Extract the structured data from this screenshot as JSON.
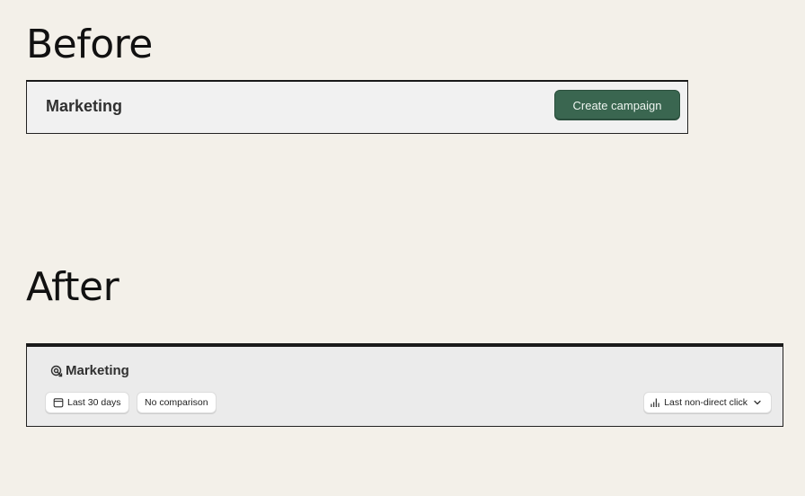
{
  "before": {
    "heading": "Before",
    "title": "Marketing",
    "create_button_label": "Create campaign"
  },
  "after": {
    "heading": "After",
    "title": "Marketing",
    "title_icon": "target-icon",
    "date_range_label": "Last 30 days",
    "date_range_icon": "calendar-icon",
    "comparison_label": "No comparison",
    "attribution_label": "Last non-direct click",
    "attribution_icon": "bar-chart-icon",
    "attribution_chevron": "chevron-down-icon"
  },
  "colors": {
    "page_background": "#f3f0e9",
    "primary_button": "#3a6650"
  }
}
